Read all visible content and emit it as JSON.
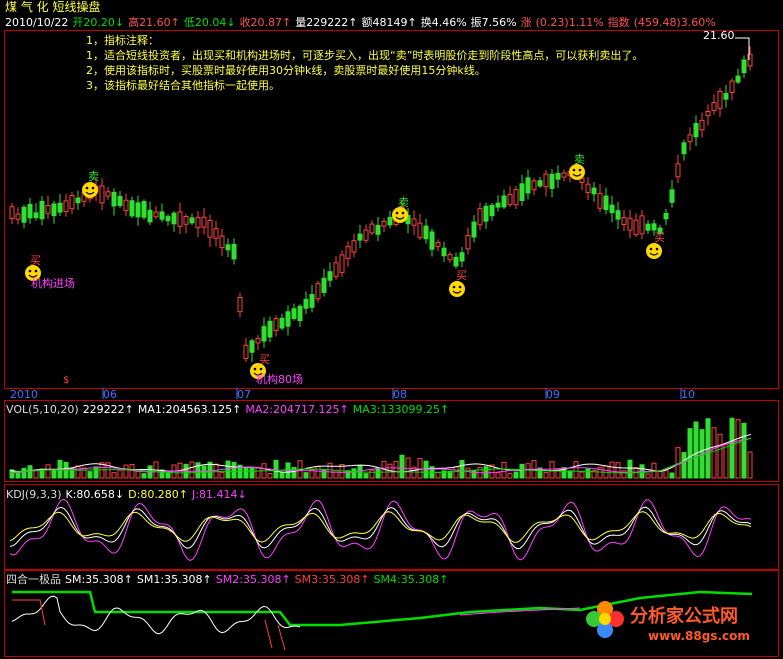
{
  "header": {
    "title": "煤 气 化 短线操盘",
    "quote": [
      {
        "text": "2010/10/22",
        "color": "#ffffff"
      },
      {
        "text": "开20.20↓",
        "color": "#00dd00"
      },
      {
        "text": "高21.60↑",
        "color": "#ff5050"
      },
      {
        "text": "低20.04↓",
        "color": "#00dd00"
      },
      {
        "text": "收20.87↑",
        "color": "#ff5050"
      },
      {
        "text": "量229222↑",
        "color": "#ffffff"
      },
      {
        "text": "额48149↑",
        "color": "#ffffff"
      },
      {
        "text": "换4.46%",
        "color": "#ffffff"
      },
      {
        "text": "振7.56%",
        "color": "#ffffff"
      },
      {
        "text": "涨",
        "color": "#ff5050"
      },
      {
        "text": "(0.23)1.11%",
        "color": "#ff5050"
      },
      {
        "text": "指数",
        "color": "#ff5050"
      },
      {
        "text": "(459.48)3.60%",
        "color": "#ff5050"
      }
    ]
  },
  "notes": [
    "1，指标注释：",
    "1，适合短线投资者，出现买和机构进场时，可逐步买入，出现“卖”时表明股价走到阶段性高点，可以获利卖出了。",
    "2，使用该指标时，买股票时最好使用30分钟k线，卖股票时最好使用15分钟k线。",
    "3，该指标最好结合其他指标一起使用。"
  ],
  "price_panel": {
    "high_label": "21.60",
    "signals": {
      "buy": "买",
      "sell": "卖",
      "institution": "机构进场",
      "institution2": "机构80场"
    },
    "extra_mark": "$",
    "months": [
      "2010",
      "06",
      "07",
      "08",
      "09",
      "10"
    ],
    "colors": {
      "up": "#ff4040",
      "down": "#30e030"
    }
  },
  "vol_panel": {
    "items": [
      {
        "text": "VOL(5,10,20)",
        "color": "#dddddd"
      },
      {
        "text": "229222↑",
        "color": "#ffffff"
      },
      {
        "text": "MA1:204563.125↑",
        "color": "#ffffff"
      },
      {
        "text": "MA2:204717.125↑",
        "color": "#ff40ff"
      },
      {
        "text": "MA3:133099.25↑",
        "color": "#00dd00"
      }
    ]
  },
  "kdj_panel": {
    "items": [
      {
        "text": "KDJ(9,3,3)",
        "color": "#dddddd"
      },
      {
        "text": "K:80.658↓",
        "color": "#ffffff"
      },
      {
        "text": "D:80.280↑",
        "color": "#ffff40"
      },
      {
        "text": "J:81.414↓",
        "color": "#ff40ff"
      }
    ]
  },
  "four_panel": {
    "items": [
      {
        "text": "四合一极品",
        "color": "#dddddd"
      },
      {
        "text": "SM:35.308↑",
        "color": "#ffffff"
      },
      {
        "text": "SM1:35.308↑",
        "color": "#ffffff"
      },
      {
        "text": "SM2:35.308↑",
        "color": "#ff40ff"
      },
      {
        "text": "SM3:35.308↑",
        "color": "#ff4040"
      },
      {
        "text": "SM4:35.308↑",
        "color": "#00dd00"
      }
    ]
  },
  "watermark": {
    "name": "分析家公式网",
    "url": "www.88gs.com"
  }
}
